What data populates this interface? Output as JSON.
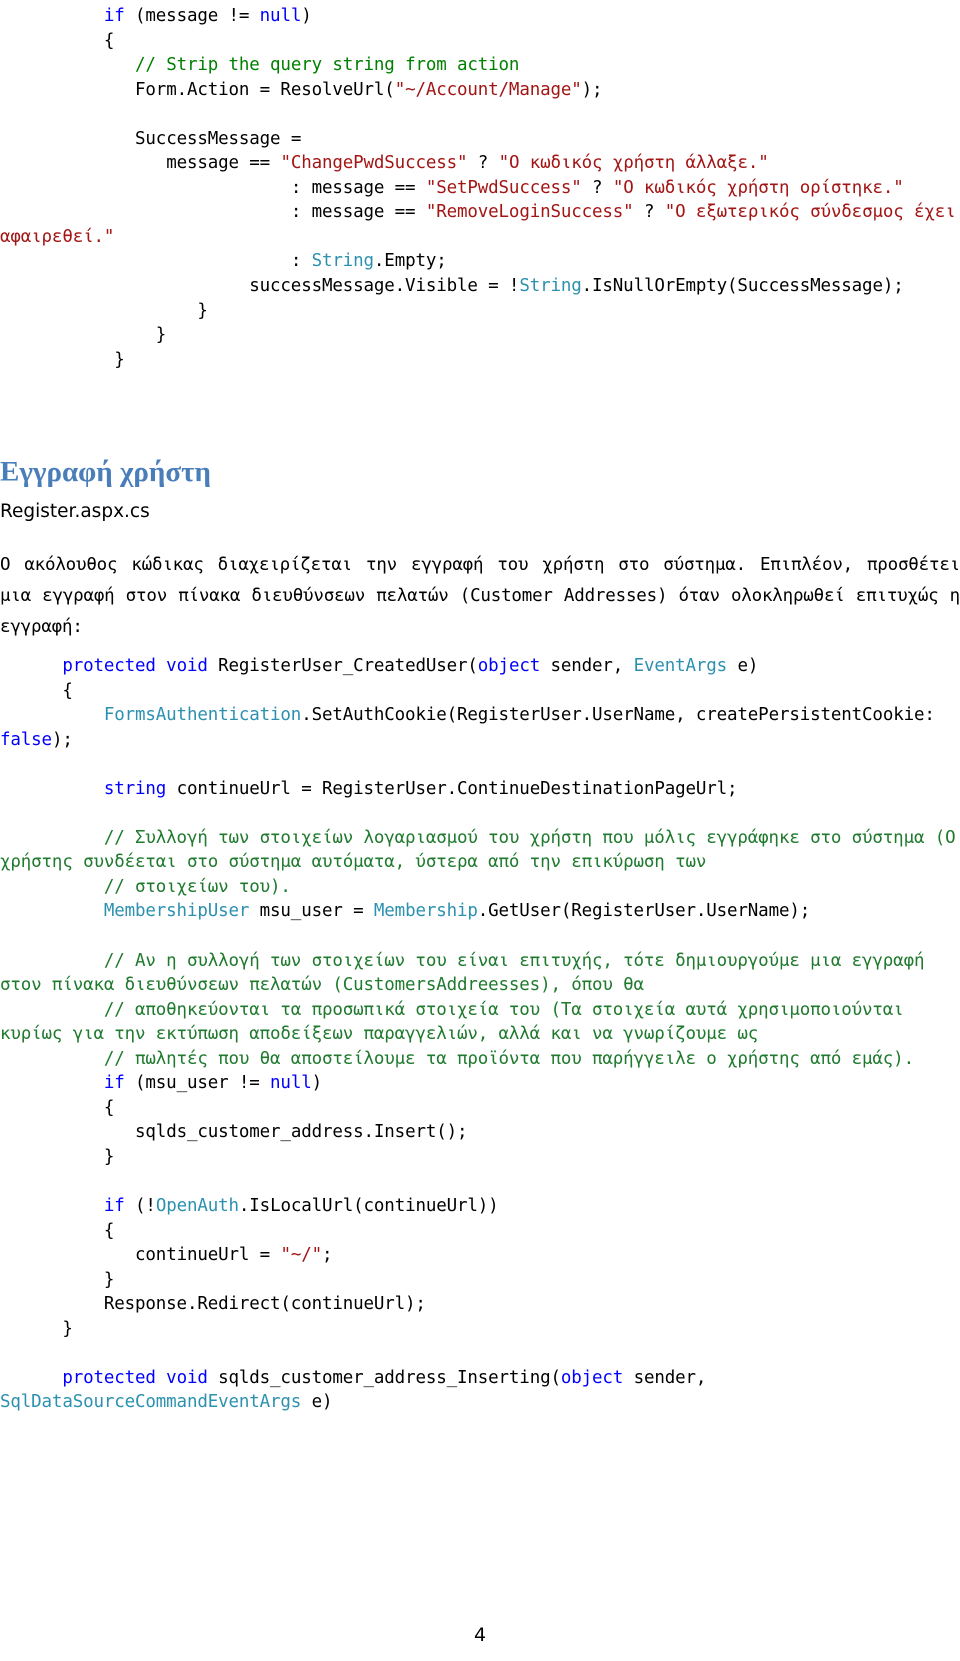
{
  "document": {
    "page_number": "4",
    "colors": {
      "keyword": "#0000ff",
      "type": "#2b91af",
      "string": "#a31515",
      "comment": "#008000",
      "heading": "#4a7ebb",
      "body": "#000000",
      "background": "#ffffff"
    }
  },
  "code_block_top": {
    "lines": [
      {
        "indent": 10,
        "tokens": [
          {
            "t": "if",
            "c": "kw"
          },
          {
            "t": " (message ",
            "c": ""
          },
          {
            "t": "!=",
            "c": ""
          },
          {
            "t": " ",
            "c": ""
          },
          {
            "t": "null",
            "c": "kw"
          },
          {
            "t": ")",
            "c": ""
          }
        ]
      },
      {
        "indent": 10,
        "tokens": [
          {
            "t": "{",
            "c": ""
          }
        ]
      },
      {
        "indent": 13,
        "tokens": [
          {
            "t": "// Strip the query string from action",
            "c": "cmt"
          }
        ]
      },
      {
        "indent": 13,
        "tokens": [
          {
            "t": "Form.Action = ResolveUrl(",
            "c": ""
          },
          {
            "t": "\"~/Account/Manage\"",
            "c": "str"
          },
          {
            "t": ");",
            "c": ""
          }
        ]
      },
      {
        "indent": 0,
        "tokens": []
      },
      {
        "indent": 13,
        "tokens": [
          {
            "t": "SuccessMessage =",
            "c": ""
          }
        ]
      },
      {
        "indent": 16,
        "tokens": [
          {
            "t": "message == ",
            "c": ""
          },
          {
            "t": "\"ChangePwdSuccess\"",
            "c": "str"
          },
          {
            "t": " ? ",
            "c": ""
          },
          {
            "t": "\"Ο κωδικός χρήστη άλλαξε.\"",
            "c": "str"
          }
        ]
      },
      {
        "indent": 28,
        "tokens": [
          {
            "t": ": message == ",
            "c": ""
          },
          {
            "t": "\"SetPwdSuccess\"",
            "c": "str"
          },
          {
            "t": " ? ",
            "c": ""
          },
          {
            "t": "\"Ο κωδικός χρήστη ορίστηκε.\"",
            "c": "str"
          }
        ]
      },
      {
        "indent": 28,
        "tokens": [
          {
            "t": ": message == ",
            "c": ""
          },
          {
            "t": "\"RemoveLoginSuccess\"",
            "c": "str"
          },
          {
            "t": " ? ",
            "c": ""
          },
          {
            "t": "\"Ο εξωτερικός σύνδεσμος έχει αφαιρεθεί.\"",
            "c": "str"
          }
        ]
      },
      {
        "indent": 28,
        "tokens": [
          {
            "t": ": ",
            "c": ""
          },
          {
            "t": "String",
            "c": "typ"
          },
          {
            "t": ".Empty;",
            "c": ""
          }
        ]
      },
      {
        "indent": 24,
        "tokens": [
          {
            "t": "successMessage.Visible = !",
            "c": ""
          },
          {
            "t": "String",
            "c": "typ"
          },
          {
            "t": ".IsNullOrEmpty(SuccessMessage);",
            "c": ""
          }
        ]
      },
      {
        "indent": 19,
        "tokens": [
          {
            "t": "}",
            "c": ""
          }
        ]
      },
      {
        "indent": 15,
        "tokens": [
          {
            "t": "}",
            "c": ""
          }
        ]
      },
      {
        "indent": 11,
        "tokens": [
          {
            "t": "}",
            "c": ""
          }
        ]
      }
    ]
  },
  "section": {
    "heading": "Εγγραφή χρήστη",
    "subtitle": "Register.aspx.cs",
    "paragraph": "Ο ακόλουθος κώδικας διαχειρίζεται την εγγραφή του χρήστη στο σύστημα. Επιπλέον, προσθέτει μια εγγραφή στον πίνακα διευθύνσεων πελατών (Customer Addresses) όταν ολοκληρωθεί επιτυχώς η εγγραφή:"
  },
  "code_block_main": {
    "lines": [
      {
        "indent": 6,
        "tokens": [
          {
            "t": "protected void",
            "c": "kw"
          },
          {
            "t": " RegisterUser_CreatedUser(",
            "c": ""
          },
          {
            "t": "object",
            "c": "kw"
          },
          {
            "t": " sender, ",
            "c": ""
          },
          {
            "t": "EventArgs",
            "c": "typ"
          },
          {
            "t": " e)",
            "c": ""
          }
        ]
      },
      {
        "indent": 6,
        "tokens": [
          {
            "t": "{",
            "c": ""
          }
        ]
      },
      {
        "indent": 10,
        "tokens": [
          {
            "t": "FormsAuthentication",
            "c": "typ"
          },
          {
            "t": ".SetAuthCookie(RegisterUser.UserName, createPersistentCookie: ",
            "c": ""
          },
          {
            "t": "false",
            "c": "kw"
          },
          {
            "t": ");",
            "c": ""
          }
        ]
      },
      {
        "indent": 0,
        "tokens": []
      },
      {
        "indent": 10,
        "tokens": [
          {
            "t": "string",
            "c": "kw"
          },
          {
            "t": " continueUrl = RegisterUser.ContinueDestinationPageUrl;",
            "c": ""
          }
        ]
      },
      {
        "indent": 0,
        "tokens": []
      },
      {
        "indent": 10,
        "tokens": [
          {
            "t": "// Συλλογή των στοιχείων λογαριασμού του χρήστη που μόλις εγγράφηκε στο σύστημα (Ο χρήστης συνδέεται στο σύστημα αυτόματα, ύστερα από την επικύρωση των",
            "c": "gcmt"
          }
        ]
      },
      {
        "indent": 10,
        "tokens": [
          {
            "t": "// στοιχείων του).",
            "c": "gcmt"
          }
        ]
      },
      {
        "indent": 10,
        "tokens": [
          {
            "t": "MembershipUser",
            "c": "typ"
          },
          {
            "t": " msu_user = ",
            "c": ""
          },
          {
            "t": "Membership",
            "c": "typ"
          },
          {
            "t": ".GetUser(RegisterUser.UserName);",
            "c": ""
          }
        ]
      },
      {
        "indent": 0,
        "tokens": []
      },
      {
        "indent": 10,
        "tokens": [
          {
            "t": "// Αν η συλλογή των στοιχείων του είναι επιτυχής, τότε δημιουργούμε μια εγγραφή στον πίνακα διευθύνσεων πελατών (CustomersAddreesses), όπου θα",
            "c": "gcmt"
          }
        ]
      },
      {
        "indent": 10,
        "tokens": [
          {
            "t": "// αποθηκεύονται τα προσωπικά στοιχεία του (Τα στοιχεία αυτά χρησιμοποιούνται κυρίως για την εκτύπωση αποδείξεων παραγγελιών, αλλά και να γνωρίζουμε ως",
            "c": "gcmt"
          }
        ]
      },
      {
        "indent": 10,
        "tokens": [
          {
            "t": "// πωλητές που θα αποστείλουμε τα προϊόντα που παρήγγειλε ο χρήστης από εμάς).",
            "c": "gcmt"
          }
        ]
      },
      {
        "indent": 10,
        "tokens": [
          {
            "t": "if",
            "c": "kw"
          },
          {
            "t": " (msu_user != ",
            "c": ""
          },
          {
            "t": "null",
            "c": "kw"
          },
          {
            "t": ")",
            "c": ""
          }
        ]
      },
      {
        "indent": 10,
        "tokens": [
          {
            "t": "{",
            "c": ""
          }
        ]
      },
      {
        "indent": 13,
        "tokens": [
          {
            "t": "sqlds_customer_address.Insert();",
            "c": ""
          }
        ]
      },
      {
        "indent": 10,
        "tokens": [
          {
            "t": "}",
            "c": ""
          }
        ]
      },
      {
        "indent": 0,
        "tokens": []
      },
      {
        "indent": 10,
        "tokens": [
          {
            "t": "if",
            "c": "kw"
          },
          {
            "t": " (!",
            "c": ""
          },
          {
            "t": "OpenAuth",
            "c": "typ"
          },
          {
            "t": ".IsLocalUrl(continueUrl))",
            "c": ""
          }
        ]
      },
      {
        "indent": 10,
        "tokens": [
          {
            "t": "{",
            "c": ""
          }
        ]
      },
      {
        "indent": 13,
        "tokens": [
          {
            "t": "continueUrl = ",
            "c": ""
          },
          {
            "t": "\"~/\"",
            "c": "str"
          },
          {
            "t": ";",
            "c": ""
          }
        ]
      },
      {
        "indent": 10,
        "tokens": [
          {
            "t": "}",
            "c": ""
          }
        ]
      },
      {
        "indent": 10,
        "tokens": [
          {
            "t": "Response.Redirect(continueUrl);",
            "c": ""
          }
        ]
      },
      {
        "indent": 6,
        "tokens": [
          {
            "t": "}",
            "c": ""
          }
        ]
      },
      {
        "indent": 0,
        "tokens": []
      },
      {
        "indent": 6,
        "tokens": [
          {
            "t": "protected void",
            "c": "kw"
          },
          {
            "t": " sqlds_customer_address_Inserting(",
            "c": ""
          },
          {
            "t": "object",
            "c": "kw"
          },
          {
            "t": " sender, ",
            "c": ""
          },
          {
            "t": "SqlDataSourceCommandEventArgs",
            "c": "typ"
          },
          {
            "t": " e)",
            "c": ""
          }
        ]
      }
    ]
  }
}
